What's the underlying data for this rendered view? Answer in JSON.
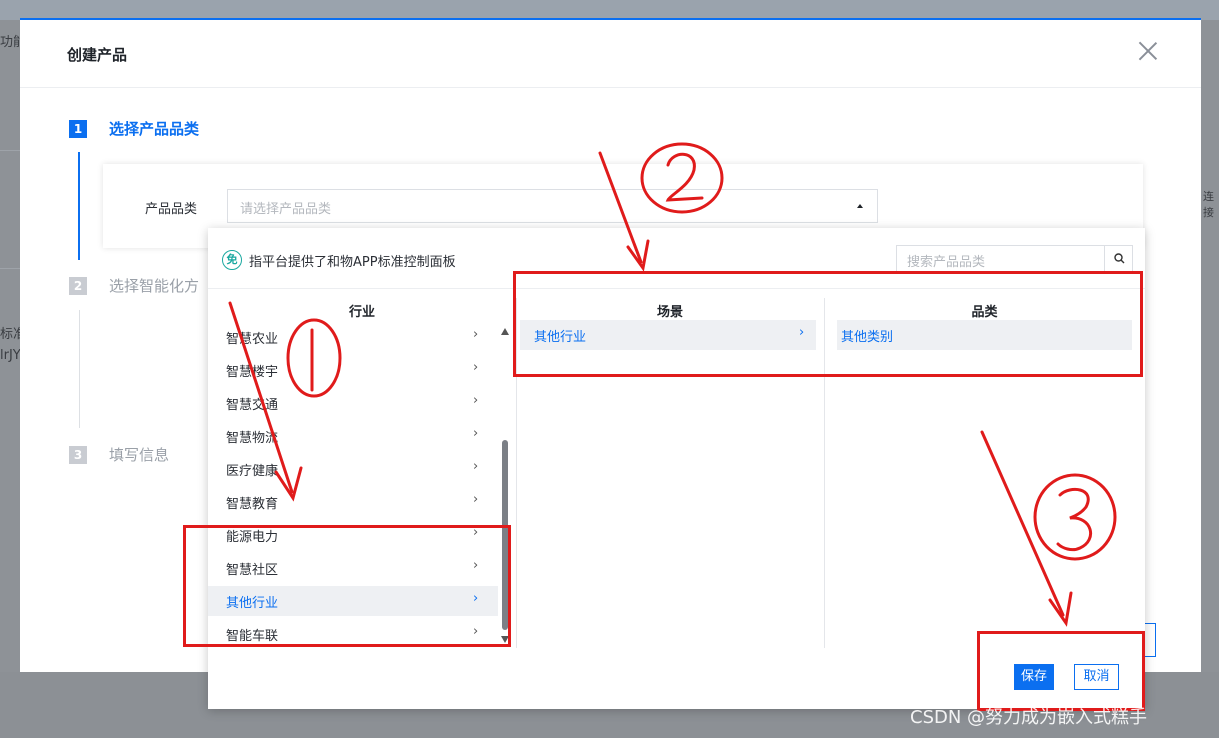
{
  "background": {
    "fragments": [
      "功能",
      "标准",
      "lrJY",
      "连接"
    ]
  },
  "modal": {
    "title": "创建产品",
    "steps": [
      {
        "num": "1",
        "label": "选择产品品类"
      },
      {
        "num": "2",
        "label": "选择智能化方"
      },
      {
        "num": "3",
        "label": "填写信息"
      }
    ]
  },
  "form": {
    "label": "产品品类",
    "placeholder": "请选择产品品类"
  },
  "dropdown": {
    "hint_badge": "免",
    "hint": "指平台提供了和物APP标准控制面板",
    "search_placeholder": "搜索产品品类",
    "columns": {
      "industry": {
        "header": "行业",
        "items": [
          "智慧农业",
          "智慧楼宇",
          "智慧交通",
          "智慧物流",
          "医疗健康",
          "智慧教育",
          "能源电力",
          "智慧社区",
          "其他行业",
          "智能车联"
        ],
        "selected": "其他行业"
      },
      "scene": {
        "header": "场景",
        "items": [
          "其他行业"
        ],
        "selected": "其他行业"
      },
      "category": {
        "header": "品类",
        "items": [
          "其他类别"
        ],
        "selected": "其他类别"
      }
    },
    "save_label": "保存",
    "cancel_label": "取消"
  },
  "annotations": {
    "circle_labels": [
      "①",
      "②",
      "③"
    ],
    "color": "#e01b1b"
  },
  "watermark": "CSDN @努力成为嵌入式糕手",
  "colors": {
    "accent": "#0b6ff0",
    "annotation": "#e01b1b"
  }
}
